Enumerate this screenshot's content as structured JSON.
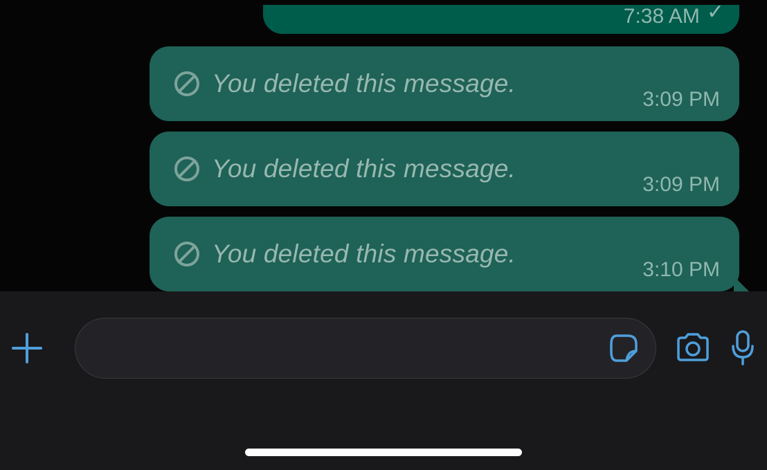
{
  "chat": {
    "partial_bubble_time": "7:38 AM",
    "deleted_label": "You deleted this message.",
    "bubbles": [
      {
        "time": "3:09 PM"
      },
      {
        "time": "3:09 PM"
      },
      {
        "time": "3:10 PM"
      }
    ]
  },
  "composer": {
    "placeholder": ""
  }
}
